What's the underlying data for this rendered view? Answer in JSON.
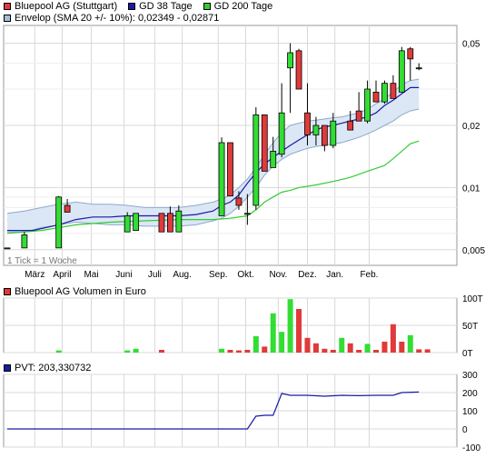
{
  "legend_price": [
    {
      "label": "Bluepool AG (Stuttgart)",
      "color": "#e03a3a"
    },
    {
      "label": "GD 38 Tage",
      "color": "#1a1aa6"
    },
    {
      "label": "GD 200 Tage",
      "color": "#33cc33"
    }
  ],
  "legend_envelop": {
    "label": "Envelop (SMA 20 +/- 10%): 0,02349 - 0,02871",
    "color": "#a6bcd8"
  },
  "legend_volume": {
    "label": "Bluepool AG Volumen in Euro",
    "color": "#e03a3a"
  },
  "legend_pvt": {
    "label": "PVT: 203,330732",
    "color": "#1a1aa6"
  },
  "tick_note": "1 Tick = 1 Woche",
  "colors": {
    "up": "#33dd33",
    "down": "#e03a3a",
    "gd38": "#1a1aa6",
    "gd200": "#33cc33",
    "envelope_fill": "#dbe7f5",
    "envelope_line": "#8ea8cc",
    "pvt": "#1a1aa6",
    "grid": "#d8d8d8"
  },
  "chart_data": [
    {
      "type": "candlestick",
      "title": "Bluepool AG (Stuttgart)",
      "y_scale": "log",
      "ylim": [
        0.0042,
        0.061
      ],
      "y_ticks": [
        {
          "value": 0.005,
          "label": "0,005"
        },
        {
          "value": 0.01,
          "label": "0,01"
        },
        {
          "value": 0.02,
          "label": "0,02"
        },
        {
          "value": 0.05,
          "label": "0,05"
        }
      ],
      "x_range": [
        0,
        52
      ],
      "x_ticks": [
        {
          "x": 3.2,
          "label": "März"
        },
        {
          "x": 6.4,
          "label": "April"
        },
        {
          "x": 9.8,
          "label": "Mai"
        },
        {
          "x": 13.6,
          "label": "Juni"
        },
        {
          "x": 17.2,
          "label": "Juli"
        },
        {
          "x": 20.4,
          "label": "Aug."
        },
        {
          "x": 24.6,
          "label": "Sep."
        },
        {
          "x": 27.8,
          "label": "Okt."
        },
        {
          "x": 31.6,
          "label": "Nov."
        },
        {
          "x": 35.0,
          "label": "Dez."
        },
        {
          "x": 38.2,
          "label": "Jan."
        },
        {
          "x": 42.2,
          "label": "Feb."
        }
      ],
      "candles": [
        {
          "x": 0,
          "o": 0.0051,
          "h": 0.0051,
          "l": 0.0051,
          "c": 0.0051
        },
        {
          "x": 2,
          "o": 0.0051,
          "h": 0.0061,
          "l": 0.0051,
          "c": 0.0059
        },
        {
          "x": 6,
          "o": 0.0051,
          "h": 0.0091,
          "l": 0.0051,
          "c": 0.009
        },
        {
          "x": 7,
          "o": 0.0082,
          "h": 0.0088,
          "l": 0.0076,
          "c": 0.0076
        },
        {
          "x": 14,
          "o": 0.0061,
          "h": 0.0076,
          "l": 0.0061,
          "c": 0.0073
        },
        {
          "x": 15,
          "o": 0.0062,
          "h": 0.0075,
          "l": 0.0062,
          "c": 0.0075
        },
        {
          "x": 18,
          "o": 0.0075,
          "h": 0.0075,
          "l": 0.0061,
          "c": 0.0061
        },
        {
          "x": 19,
          "o": 0.0075,
          "h": 0.0081,
          "l": 0.0061,
          "c": 0.0061
        },
        {
          "x": 20,
          "o": 0.0061,
          "h": 0.0082,
          "l": 0.0061,
          "c": 0.0077
        },
        {
          "x": 25,
          "o": 0.0073,
          "h": 0.0175,
          "l": 0.0073,
          "c": 0.0165
        },
        {
          "x": 26,
          "o": 0.0165,
          "h": 0.0165,
          "l": 0.0091,
          "c": 0.0091
        },
        {
          "x": 27,
          "o": 0.0089,
          "h": 0.0096,
          "l": 0.0078,
          "c": 0.0082
        },
        {
          "x": 28,
          "o": 0.0075,
          "h": 0.0093,
          "l": 0.0066,
          "c": 0.0075
        },
        {
          "x": 29,
          "o": 0.0082,
          "h": 0.0245,
          "l": 0.0078,
          "c": 0.0225
        },
        {
          "x": 30,
          "o": 0.0225,
          "h": 0.0225,
          "l": 0.012,
          "c": 0.012
        },
        {
          "x": 31,
          "o": 0.0125,
          "h": 0.0176,
          "l": 0.0125,
          "c": 0.015
        },
        {
          "x": 32,
          "o": 0.0145,
          "h": 0.032,
          "l": 0.014,
          "c": 0.023
        },
        {
          "x": 33,
          "o": 0.038,
          "h": 0.05,
          "l": 0.023,
          "c": 0.045
        },
        {
          "x": 34,
          "o": 0.046,
          "h": 0.047,
          "l": 0.03,
          "c": 0.03
        },
        {
          "x": 35,
          "o": 0.023,
          "h": 0.032,
          "l": 0.016,
          "c": 0.018
        },
        {
          "x": 36,
          "o": 0.018,
          "h": 0.022,
          "l": 0.016,
          "c": 0.02
        },
        {
          "x": 37,
          "o": 0.02,
          "h": 0.02,
          "l": 0.015,
          "c": 0.016
        },
        {
          "x": 38,
          "o": 0.016,
          "h": 0.023,
          "l": 0.0155,
          "c": 0.021
        },
        {
          "x": 40,
          "o": 0.021,
          "h": 0.0235,
          "l": 0.019,
          "c": 0.019
        },
        {
          "x": 41,
          "o": 0.0235,
          "h": 0.029,
          "l": 0.021,
          "c": 0.021
        },
        {
          "x": 42,
          "o": 0.021,
          "h": 0.033,
          "l": 0.0205,
          "c": 0.03
        },
        {
          "x": 43,
          "o": 0.029,
          "h": 0.033,
          "l": 0.026,
          "c": 0.026
        },
        {
          "x": 44,
          "o": 0.026,
          "h": 0.033,
          "l": 0.0255,
          "c": 0.032
        },
        {
          "x": 45,
          "o": 0.032,
          "h": 0.035,
          "l": 0.027,
          "c": 0.027
        },
        {
          "x": 46,
          "o": 0.029,
          "h": 0.048,
          "l": 0.029,
          "c": 0.046
        },
        {
          "x": 47,
          "o": 0.047,
          "h": 0.048,
          "l": 0.033,
          "c": 0.042
        },
        {
          "x": 48,
          "o": 0.038,
          "h": 0.04,
          "l": 0.037,
          "c": 0.038
        }
      ],
      "gd38": [
        [
          0,
          0.0062
        ],
        [
          3,
          0.0062
        ],
        [
          6,
          0.0066
        ],
        [
          8,
          0.007
        ],
        [
          10,
          0.0072
        ],
        [
          12,
          0.0072
        ],
        [
          14,
          0.0073
        ],
        [
          16,
          0.0073
        ],
        [
          18,
          0.0073
        ],
        [
          20,
          0.0073
        ],
        [
          22,
          0.0074
        ],
        [
          24,
          0.0077
        ],
        [
          25,
          0.0082
        ],
        [
          26,
          0.0085
        ],
        [
          27,
          0.0092
        ],
        [
          28,
          0.0105
        ],
        [
          29,
          0.0118
        ],
        [
          30,
          0.013
        ],
        [
          31,
          0.014
        ],
        [
          32,
          0.015
        ],
        [
          33,
          0.016
        ],
        [
          34,
          0.017
        ],
        [
          35,
          0.018
        ],
        [
          36,
          0.019
        ],
        [
          37,
          0.0197
        ],
        [
          38,
          0.02
        ],
        [
          39,
          0.0205
        ],
        [
          40,
          0.021
        ],
        [
          41,
          0.0215
        ],
        [
          42,
          0.022
        ],
        [
          43,
          0.023
        ],
        [
          44,
          0.025
        ],
        [
          45,
          0.0265
        ],
        [
          46,
          0.0285
        ],
        [
          47,
          0.0305
        ],
        [
          48,
          0.0305
        ]
      ],
      "gd200": [
        [
          0,
          0.006
        ],
        [
          4,
          0.0062
        ],
        [
          8,
          0.0066
        ],
        [
          12,
          0.0068
        ],
        [
          16,
          0.0069
        ],
        [
          20,
          0.007
        ],
        [
          24,
          0.007
        ],
        [
          26,
          0.0071
        ],
        [
          28,
          0.0073
        ],
        [
          29,
          0.0078
        ],
        [
          30,
          0.0085
        ],
        [
          31,
          0.009
        ],
        [
          32,
          0.0095
        ],
        [
          33,
          0.0097
        ],
        [
          34,
          0.01
        ],
        [
          36,
          0.0103
        ],
        [
          38,
          0.0107
        ],
        [
          40,
          0.0112
        ],
        [
          42,
          0.012
        ],
        [
          44,
          0.0128
        ],
        [
          45,
          0.0138
        ],
        [
          46,
          0.015
        ],
        [
          47,
          0.0163
        ],
        [
          48,
          0.0168
        ]
      ],
      "envelope_upper": [
        [
          0,
          0.0075
        ],
        [
          2,
          0.0077
        ],
        [
          4,
          0.008
        ],
        [
          6,
          0.0083
        ],
        [
          8,
          0.0085
        ],
        [
          10,
          0.0083
        ],
        [
          12,
          0.0083
        ],
        [
          14,
          0.0082
        ],
        [
          16,
          0.008
        ],
        [
          18,
          0.008
        ],
        [
          20,
          0.008
        ],
        [
          22,
          0.0082
        ],
        [
          24,
          0.0085
        ],
        [
          25,
          0.0088
        ],
        [
          26,
          0.0092
        ],
        [
          27,
          0.01
        ],
        [
          28,
          0.011
        ],
        [
          29,
          0.0125
        ],
        [
          30,
          0.0145
        ],
        [
          31,
          0.0165
        ],
        [
          32,
          0.0185
        ],
        [
          33,
          0.02
        ],
        [
          34,
          0.0205
        ],
        [
          35,
          0.021
        ],
        [
          36,
          0.0212
        ],
        [
          37,
          0.0215
        ],
        [
          38,
          0.0218
        ],
        [
          39,
          0.022
        ],
        [
          40,
          0.0225
        ],
        [
          41,
          0.023
        ],
        [
          42,
          0.024
        ],
        [
          43,
          0.0255
        ],
        [
          44,
          0.027
        ],
        [
          45,
          0.029
        ],
        [
          46,
          0.0315
        ],
        [
          47,
          0.033
        ],
        [
          48,
          0.0335
        ]
      ],
      "envelope_lower": [
        [
          0,
          0.0061
        ],
        [
          2,
          0.0061
        ],
        [
          4,
          0.0064
        ],
        [
          6,
          0.0066
        ],
        [
          8,
          0.0068
        ],
        [
          10,
          0.0067
        ],
        [
          12,
          0.0066
        ],
        [
          14,
          0.0066
        ],
        [
          16,
          0.0065
        ],
        [
          18,
          0.0065
        ],
        [
          20,
          0.0065
        ],
        [
          22,
          0.0066
        ],
        [
          24,
          0.0069
        ],
        [
          25,
          0.0071
        ],
        [
          26,
          0.0075
        ],
        [
          27,
          0.0081
        ],
        [
          28,
          0.009
        ],
        [
          29,
          0.01
        ],
        [
          30,
          0.0115
        ],
        [
          31,
          0.0127
        ],
        [
          32,
          0.0137
        ],
        [
          33,
          0.0145
        ],
        [
          34,
          0.015
        ],
        [
          35,
          0.0155
        ],
        [
          36,
          0.0158
        ],
        [
          37,
          0.016
        ],
        [
          38,
          0.0163
        ],
        [
          39,
          0.0165
        ],
        [
          40,
          0.017
        ],
        [
          41,
          0.0175
        ],
        [
          42,
          0.0182
        ],
        [
          43,
          0.019
        ],
        [
          44,
          0.02
        ],
        [
          45,
          0.021
        ],
        [
          46,
          0.0225
        ],
        [
          47,
          0.0235
        ],
        [
          48,
          0.024
        ]
      ]
    },
    {
      "type": "bar",
      "title": "Bluepool AG Volumen in Euro",
      "ylim": [
        0,
        100
      ],
      "y_ticks": [
        {
          "value": 0,
          "label": "0T"
        },
        {
          "value": 50,
          "label": "50T"
        },
        {
          "value": 100,
          "label": "100T"
        }
      ],
      "bars": [
        {
          "x": 6,
          "v": 4,
          "up": true
        },
        {
          "x": 14,
          "v": 4,
          "up": true
        },
        {
          "x": 15,
          "v": 7,
          "up": true
        },
        {
          "x": 18,
          "v": 5,
          "up": false
        },
        {
          "x": 25,
          "v": 7,
          "up": true
        },
        {
          "x": 26,
          "v": 5,
          "up": false
        },
        {
          "x": 27,
          "v": 4,
          "up": false
        },
        {
          "x": 28,
          "v": 5,
          "up": false
        },
        {
          "x": 29,
          "v": 30,
          "up": true
        },
        {
          "x": 30,
          "v": 11,
          "up": false
        },
        {
          "x": 31,
          "v": 72,
          "up": true
        },
        {
          "x": 32,
          "v": 38,
          "up": true
        },
        {
          "x": 33,
          "v": 98,
          "up": true
        },
        {
          "x": 34,
          "v": 80,
          "up": false
        },
        {
          "x": 35,
          "v": 27,
          "up": false
        },
        {
          "x": 36,
          "v": 17,
          "up": false
        },
        {
          "x": 37,
          "v": 7,
          "up": false
        },
        {
          "x": 38,
          "v": 5,
          "up": false
        },
        {
          "x": 39,
          "v": 27,
          "up": true
        },
        {
          "x": 40,
          "v": 17,
          "up": false
        },
        {
          "x": 41,
          "v": 5,
          "up": false
        },
        {
          "x": 42,
          "v": 16,
          "up": true
        },
        {
          "x": 43,
          "v": 5,
          "up": false
        },
        {
          "x": 44,
          "v": 20,
          "up": false
        },
        {
          "x": 45,
          "v": 52,
          "up": false
        },
        {
          "x": 46,
          "v": 20,
          "up": false
        },
        {
          "x": 47,
          "v": 32,
          "up": true
        },
        {
          "x": 48,
          "v": 6,
          "up": false
        },
        {
          "x": 49,
          "v": 6,
          "up": false
        }
      ]
    },
    {
      "type": "line",
      "title": "PVT: 203,330732",
      "ylim": [
        -100,
        300
      ],
      "y_ticks": [
        {
          "value": -100,
          "label": "-100"
        },
        {
          "value": 0,
          "label": "0"
        },
        {
          "value": 100,
          "label": "100"
        },
        {
          "value": 200,
          "label": "200"
        },
        {
          "value": 300,
          "label": "300"
        }
      ],
      "points": [
        [
          0,
          0
        ],
        [
          28,
          0
        ],
        [
          29,
          70
        ],
        [
          30,
          75
        ],
        [
          31,
          75
        ],
        [
          32,
          195
        ],
        [
          33,
          185
        ],
        [
          35,
          185
        ],
        [
          37,
          180
        ],
        [
          39,
          185
        ],
        [
          41,
          183
        ],
        [
          43,
          185
        ],
        [
          45,
          185
        ],
        [
          46,
          200
        ],
        [
          48,
          203
        ]
      ]
    }
  ]
}
